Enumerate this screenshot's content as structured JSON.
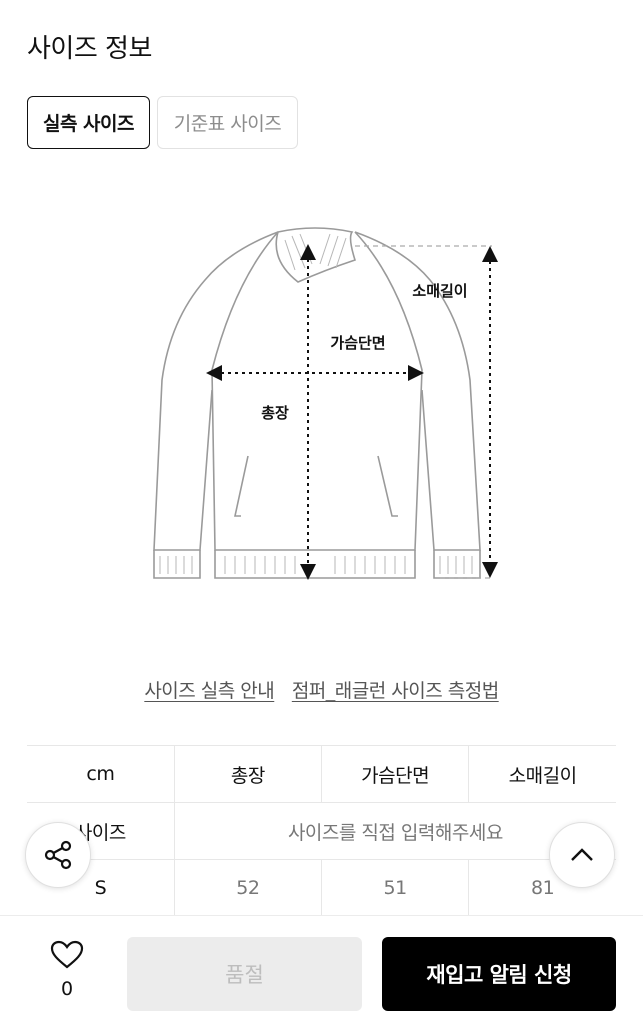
{
  "page": {
    "title": "사이즈 정보"
  },
  "tabs": [
    {
      "label": "실측 사이즈",
      "active": true
    },
    {
      "label": "기준표 사이즈",
      "active": false
    }
  ],
  "diagram": {
    "labels": {
      "sleeve": "소매길이",
      "chest": "가슴단면",
      "length": "총장"
    }
  },
  "links": [
    {
      "label": "사이즈 실측 안내"
    },
    {
      "label": "점퍼_래글런 사이즈 측정법"
    }
  ],
  "size_table": {
    "headers": [
      "cm",
      "총장",
      "가슴단면",
      "소매길이"
    ],
    "input_row": {
      "label": "사이즈",
      "hint": "사이즈를 직접 입력해주세요"
    },
    "rows": [
      {
        "size": "S",
        "values": [
          "52",
          "51",
          "81"
        ]
      }
    ]
  },
  "floating": {
    "share_icon": "share-icon",
    "top_icon": "chevron-up-icon"
  },
  "bottom_bar": {
    "like_icon": "heart-icon",
    "like_count": "0",
    "soldout_label": "품절",
    "restock_label": "재입고 알림 신청"
  }
}
